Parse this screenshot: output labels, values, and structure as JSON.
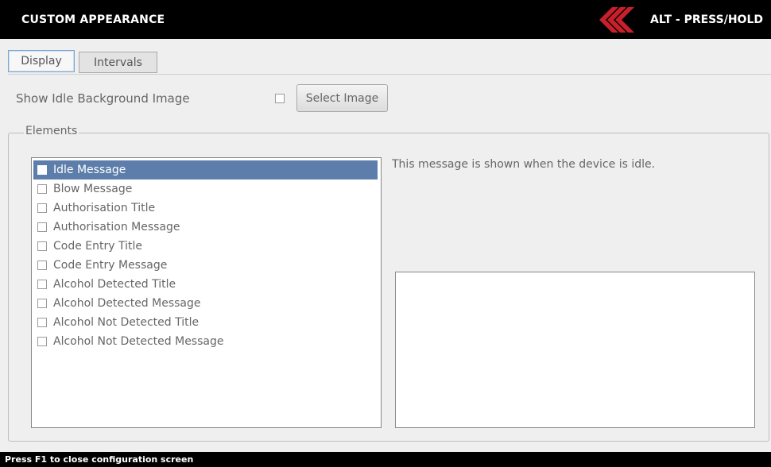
{
  "header": {
    "title": "CUSTOM APPEARANCE",
    "mode_label": "ALT - PRESS/HOLD",
    "accent_color": "#c8202b"
  },
  "tabs": [
    {
      "label": "Display",
      "active": true
    },
    {
      "label": "Intervals",
      "active": false
    }
  ],
  "idle_background": {
    "label": "Show Idle Background Image",
    "checked": false,
    "button_label": "Select Image"
  },
  "elements": {
    "legend": "Elements",
    "items": [
      {
        "label": "Idle Message",
        "checked": false,
        "selected": true
      },
      {
        "label": "Blow Message",
        "checked": false,
        "selected": false
      },
      {
        "label": "Authorisation Title",
        "checked": false,
        "selected": false
      },
      {
        "label": "Authorisation Message",
        "checked": false,
        "selected": false
      },
      {
        "label": "Code Entry Title",
        "checked": false,
        "selected": false
      },
      {
        "label": "Code Entry Message",
        "checked": false,
        "selected": false
      },
      {
        "label": "Alcohol Detected Title",
        "checked": false,
        "selected": false
      },
      {
        "label": "Alcohol Detected Message",
        "checked": false,
        "selected": false
      },
      {
        "label": "Alcohol Not Detected Title",
        "checked": false,
        "selected": false
      },
      {
        "label": "Alcohol Not Detected Message",
        "checked": false,
        "selected": false
      }
    ],
    "description": "This message is shown when the device is idle.",
    "preview_text": ""
  },
  "footer": {
    "hint": "Press F1 to close configuration screen"
  }
}
